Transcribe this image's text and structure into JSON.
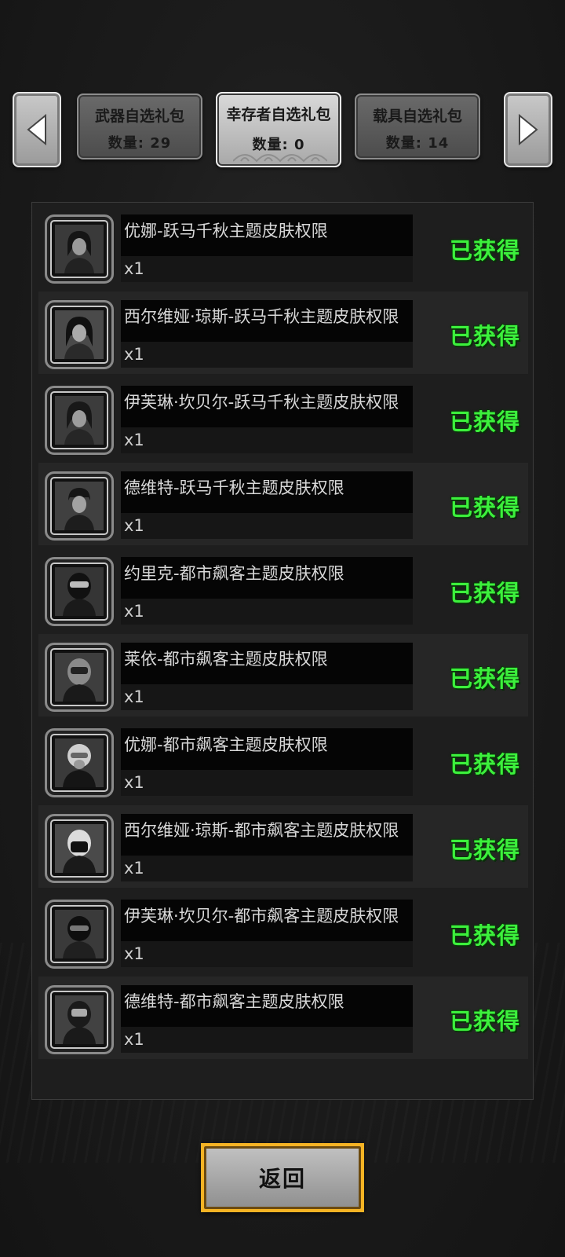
{
  "tabs": {
    "prev_icon": "chevron-left-icon",
    "next_icon": "chevron-right-icon",
    "items": [
      {
        "title": "武器自选礼包",
        "count": "数量: 29",
        "active": false
      },
      {
        "title": "幸存者自选礼包",
        "count": "数量: 0",
        "active": true
      },
      {
        "title": "载具自选礼包",
        "count": "数量: 14",
        "active": false
      }
    ]
  },
  "list": {
    "items": [
      {
        "name": "优娜-跃马千秋主题皮肤权限",
        "qty": "x1",
        "status": "已获得",
        "avatar": "character-portrait-icon"
      },
      {
        "name": "西尔维娅·琼斯-跃马千秋主题皮肤权限",
        "qty": "x1",
        "status": "已获得",
        "avatar": "character-portrait-icon"
      },
      {
        "name": "伊芙琳·坎贝尔-跃马千秋主题皮肤权限",
        "qty": "x1",
        "status": "已获得",
        "avatar": "character-portrait-icon"
      },
      {
        "name": "德维特-跃马千秋主题皮肤权限",
        "qty": "x1",
        "status": "已获得",
        "avatar": "character-portrait-icon"
      },
      {
        "name": "约里克-都市飙客主题皮肤权限",
        "qty": "x1",
        "status": "已获得",
        "avatar": "helmet-portrait-icon"
      },
      {
        "name": "莱依-都市飙客主题皮肤权限",
        "qty": "x1",
        "status": "已获得",
        "avatar": "helmet-portrait-icon"
      },
      {
        "name": "优娜-都市飙客主题皮肤权限",
        "qty": "x1",
        "status": "已获得",
        "avatar": "helmet-portrait-icon"
      },
      {
        "name": "西尔维娅·琼斯-都市飙客主题皮肤权限",
        "qty": "x1",
        "status": "已获得",
        "avatar": "helmet-portrait-icon"
      },
      {
        "name": "伊芙琳·坎贝尔-都市飙客主题皮肤权限",
        "qty": "x1",
        "status": "已获得",
        "avatar": "helmet-portrait-icon"
      },
      {
        "name": "德维特-都市飙客主题皮肤权限",
        "qty": "x1",
        "status": "已获得",
        "avatar": "helmet-portrait-icon"
      }
    ],
    "status_color": "#3cf03c"
  },
  "footer": {
    "back_label": "返回",
    "accent_color": "#f5b324"
  }
}
